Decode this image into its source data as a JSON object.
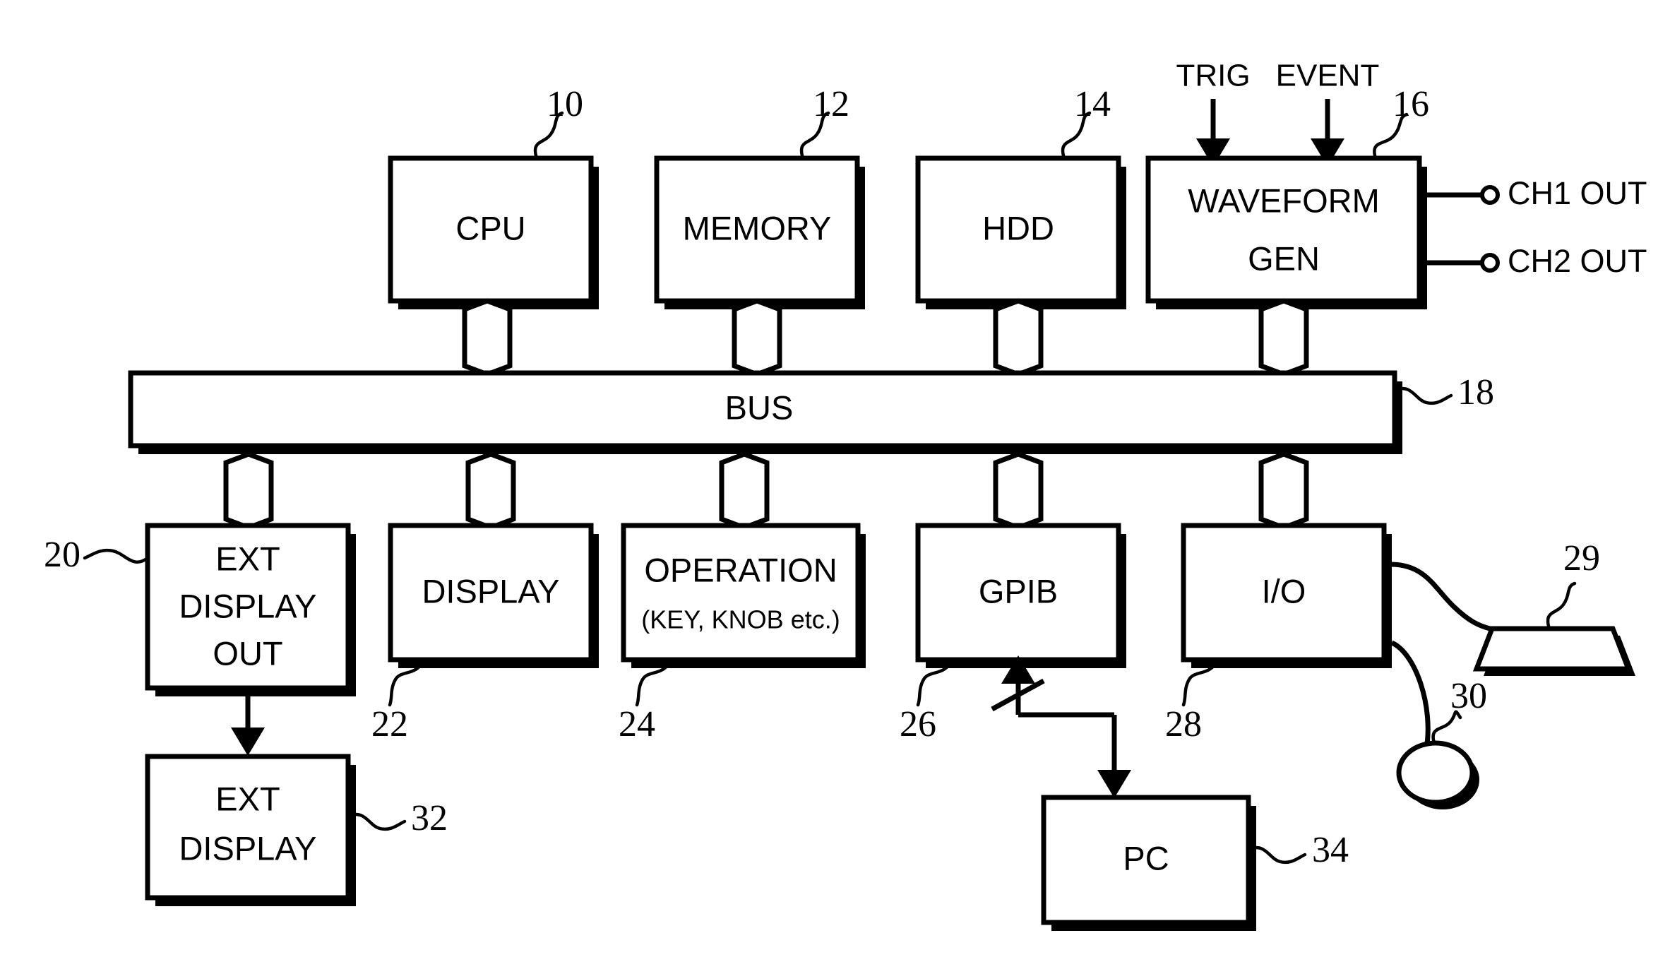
{
  "figure": {
    "type": "patent-block-diagram",
    "background_color": "#ffffff",
    "line_color": "#000000"
  },
  "blocks": {
    "cpu": {
      "label": "CPU",
      "ref": "10"
    },
    "memory": {
      "label": "MEMORY",
      "ref": "12"
    },
    "hdd": {
      "label": "HDD",
      "ref": "14"
    },
    "waveform_gen": {
      "label_line1": "WAVEFORM",
      "label_line2": "GEN",
      "ref": "16"
    },
    "bus": {
      "label": "BUS",
      "ref": "18"
    },
    "ext_display_out": {
      "label_line1": "EXT",
      "label_line2": "DISPLAY",
      "label_line3": "OUT",
      "ref": "20"
    },
    "display": {
      "label": "DISPLAY",
      "ref": "22"
    },
    "operation": {
      "label_line1": "OPERATION",
      "label_line2": "(KEY, KNOB etc.)",
      "ref": "24"
    },
    "gpib": {
      "label": "GPIB",
      "ref": "26"
    },
    "io": {
      "label": "I/O",
      "ref": "28"
    },
    "keyboard": {
      "ref": "29"
    },
    "mouse": {
      "ref": "30"
    },
    "ext_display": {
      "label_line1": "EXT",
      "label_line2": "DISPLAY",
      "ref": "32"
    },
    "pc": {
      "label": "PC",
      "ref": "34"
    }
  },
  "signals": {
    "trig": "TRIG",
    "event": "EVENT",
    "ch1_out": "CH1 OUT",
    "ch2_out": "CH2 OUT"
  }
}
